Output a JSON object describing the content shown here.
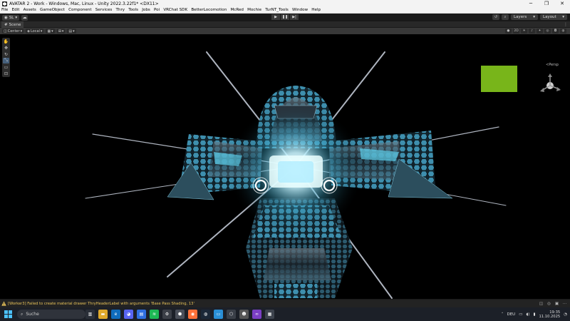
{
  "window": {
    "title": "AVATAR 2 - Work - Windows, Mac, Linux - Unity 2022.3.22f1* <DX11>",
    "minimize_glyph": "─",
    "maximize_glyph": "❐",
    "close_glyph": "✕"
  },
  "menu": [
    "File",
    "Edit",
    "Assets",
    "GameObject",
    "Component",
    "Services",
    "Thry",
    "Tools",
    "Jobs",
    "Poi",
    "VRChat SDK",
    "BetterLocomotion",
    "McRed",
    "Mochie",
    "TurNT_Tools",
    "Window",
    "Help"
  ],
  "toolbar": {
    "account_label": "SL",
    "layers_label": "Layers",
    "layout_label": "Layout"
  },
  "scene": {
    "tab_label": "Scene",
    "pivot_label": "Center",
    "space_label": "Local",
    "persp_label": "<Persp"
  },
  "console": {
    "message": "[Worker3] Failed to create material drawer ThryHeaderLabel with arguments 'Base Pass Shading, 13'"
  },
  "taskbar": {
    "search_placeholder": "Suche",
    "language": "DEU",
    "time": "19:35",
    "date": "11.10.2025"
  },
  "colors": {
    "unity_dark": "#191919",
    "scene_toolbar": "#383838",
    "warning": "#e8c35a",
    "green_box": "#78b51a",
    "accent_cyan": "#7fe9ff"
  }
}
